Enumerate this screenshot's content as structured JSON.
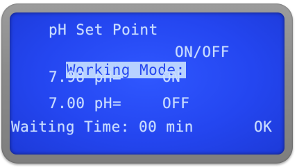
{
  "lcd": {
    "title": "pH Set Point",
    "working_mode_label": "Working Mode:",
    "working_mode_value": "ON/OFF",
    "row_on": {
      "value": "7.98 pH=",
      "state": "ON"
    },
    "row_off": {
      "value": "7.00 pH=",
      "state": "OFF"
    },
    "waiting_label": "Waiting Time:",
    "waiting_value": "00 min",
    "ok_label": "OK"
  },
  "colors": {
    "screen_bg": "#2446f0",
    "text": "#c9ddff",
    "highlight_bg": "#b8d2ff",
    "bezel": "#8a8a8a"
  }
}
